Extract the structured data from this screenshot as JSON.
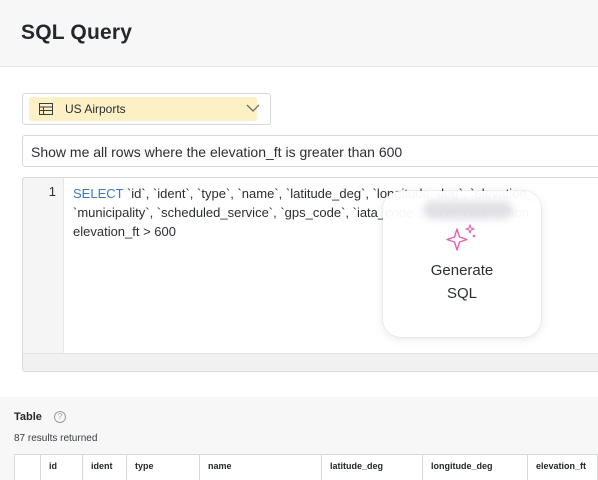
{
  "header": {
    "title": "SQL Query"
  },
  "table_select": {
    "selected": "US Airports",
    "table_icon": "table-icon",
    "chevron_icon": "chevron-down-icon"
  },
  "prompt": {
    "value": "Show me all rows where the elevation_ft is greater than 600"
  },
  "editor": {
    "line_number": "1",
    "keyword": "SELECT",
    "line1_rest": " `id`, `ident`, `type`, `name`, `latitude_deg`, `longitude_deg`, `elevation_",
    "line2": "`municipality`, `scheduled_service`, `gps_code`, `iata_code`, `local_code`, `hon",
    "line3": "elevation_ft > 600"
  },
  "generate": {
    "label_line1": "Generate",
    "label_line2": "SQL",
    "icon": "sparkle-icon",
    "accent_color": "#e65fb3"
  },
  "results": {
    "heading": "Table",
    "help_icon": "?",
    "count_text": "87 results returned",
    "columns": [
      "",
      "id",
      "ident",
      "type",
      "name",
      "latitude_deg",
      "longitude_deg",
      "elevation_ft"
    ]
  }
}
